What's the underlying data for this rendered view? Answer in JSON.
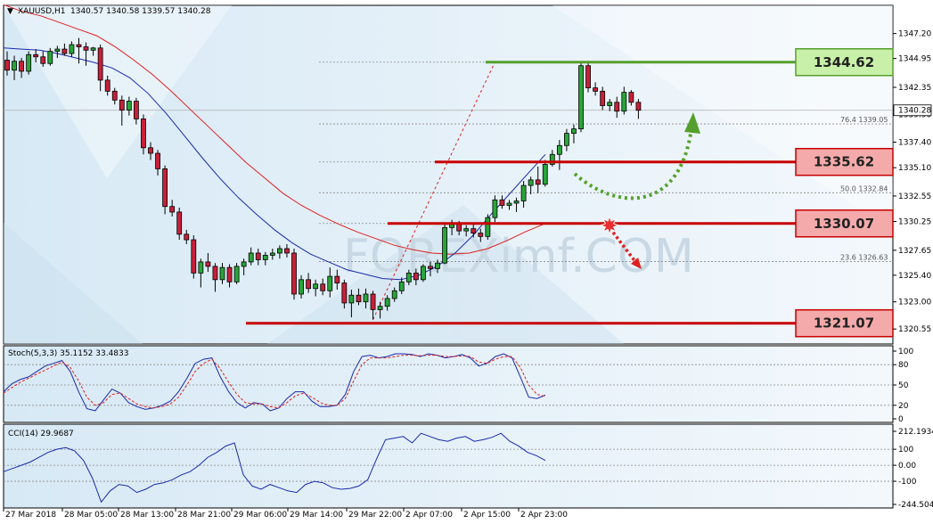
{
  "chart_data": [
    {
      "type": "candlestick",
      "title": "XAUUSD,H1",
      "ohlc_header": "1340.57 1340.58 1339.57 1340.28",
      "ylim": [
        1319.6,
        1348.7
      ],
      "y_ticks": [
        "1347.20",
        "1344.95",
        "1342.35",
        "1339.90",
        "1337.40",
        "1335.10",
        "1332.55",
        "1330.25",
        "1327.65",
        "1325.40",
        "1323.00",
        "1320.55"
      ],
      "x_ticks": [
        "27 Mar 2018",
        "28 Mar 05:00",
        "28 Mar 13:00",
        "28 Mar 21:00",
        "29 Mar 06:00",
        "29 Mar 14:00",
        "29 Mar 22:00",
        "2 Apr 07:00",
        "2 Apr 15:00",
        "2 Apr 23:00"
      ],
      "current_price": "1340.28",
      "candles": [
        [
          1344.8,
          1345.6,
          1343.4,
          1343.9
        ],
        [
          1343.9,
          1345.2,
          1343.0,
          1344.7
        ],
        [
          1344.7,
          1345.0,
          1343.2,
          1343.8
        ],
        [
          1343.8,
          1345.6,
          1343.5,
          1345.3
        ],
        [
          1345.3,
          1345.8,
          1344.6,
          1345.1
        ],
        [
          1345.1,
          1345.6,
          1344.2,
          1344.5
        ],
        [
          1344.5,
          1345.9,
          1344.3,
          1345.6
        ],
        [
          1345.6,
          1346.1,
          1345.0,
          1345.8
        ],
        [
          1345.8,
          1346.3,
          1345.2,
          1345.4
        ],
        [
          1345.4,
          1346.5,
          1345.1,
          1346.2
        ],
        [
          1346.2,
          1346.8,
          1344.5,
          1346.0
        ],
        [
          1346.0,
          1346.4,
          1344.3,
          1345.7
        ],
        [
          1345.7,
          1346.0,
          1345.2,
          1345.9
        ],
        [
          1345.9,
          1346.2,
          1342.0,
          1343.0
        ],
        [
          1343.0,
          1343.4,
          1341.6,
          1342.0
        ],
        [
          1342.0,
          1342.3,
          1340.8,
          1341.2
        ],
        [
          1341.2,
          1341.6,
          1338.9,
          1340.3
        ],
        [
          1340.3,
          1341.5,
          1339.8,
          1341.1
        ],
        [
          1341.1,
          1341.4,
          1339.0,
          1339.5
        ],
        [
          1339.5,
          1339.9,
          1336.3,
          1336.9
        ],
        [
          1336.9,
          1337.4,
          1335.8,
          1336.4
        ],
        [
          1336.4,
          1336.7,
          1334.4,
          1335.0
        ],
        [
          1335.0,
          1335.3,
          1330.9,
          1331.6
        ],
        [
          1331.6,
          1332.2,
          1330.7,
          1331.1
        ],
        [
          1331.1,
          1331.5,
          1328.6,
          1329.1
        ],
        [
          1329.1,
          1329.5,
          1328.2,
          1328.6
        ],
        [
          1328.6,
          1329.0,
          1325.1,
          1325.6
        ],
        [
          1325.6,
          1326.9,
          1324.3,
          1326.6
        ],
        [
          1326.6,
          1327.4,
          1325.7,
          1326.2
        ],
        [
          1326.2,
          1326.5,
          1323.9,
          1325.0
        ],
        [
          1325.0,
          1326.5,
          1324.6,
          1326.1
        ],
        [
          1326.1,
          1326.4,
          1324.3,
          1324.8
        ],
        [
          1324.8,
          1326.5,
          1324.6,
          1326.2
        ],
        [
          1326.2,
          1326.9,
          1325.4,
          1326.6
        ],
        [
          1326.6,
          1327.9,
          1326.3,
          1327.4
        ],
        [
          1327.4,
          1327.8,
          1326.3,
          1326.8
        ],
        [
          1326.8,
          1327.5,
          1326.3,
          1327.2
        ],
        [
          1327.2,
          1327.8,
          1326.8,
          1327.4
        ],
        [
          1327.4,
          1328.1,
          1326.9,
          1327.8
        ],
        [
          1327.8,
          1328.2,
          1327.0,
          1327.4
        ],
        [
          1327.4,
          1327.8,
          1323.2,
          1323.7
        ],
        [
          1323.7,
          1325.4,
          1323.3,
          1325.0
        ],
        [
          1325.0,
          1325.6,
          1323.8,
          1324.2
        ],
        [
          1324.2,
          1325.0,
          1323.5,
          1324.6
        ],
        [
          1324.6,
          1325.1,
          1323.6,
          1324.0
        ],
        [
          1324.0,
          1326.1,
          1323.4,
          1325.3
        ],
        [
          1325.3,
          1325.9,
          1324.1,
          1324.7
        ],
        [
          1324.7,
          1325.0,
          1322.4,
          1322.9
        ],
        [
          1322.9,
          1324.1,
          1321.6,
          1323.6
        ],
        [
          1323.6,
          1324.2,
          1322.7,
          1323.0
        ],
        [
          1323.0,
          1324.2,
          1322.4,
          1323.7
        ],
        [
          1323.7,
          1324.0,
          1321.4,
          1322.3
        ],
        [
          1322.3,
          1323.0,
          1321.5,
          1322.6
        ],
        [
          1322.6,
          1323.6,
          1322.2,
          1323.3
        ],
        [
          1323.3,
          1324.3,
          1323.0,
          1324.0
        ],
        [
          1324.0,
          1325.2,
          1323.7,
          1324.8
        ],
        [
          1324.8,
          1325.9,
          1324.5,
          1325.6
        ],
        [
          1325.6,
          1326.0,
          1324.5,
          1325.0
        ],
        [
          1325.0,
          1326.4,
          1324.8,
          1326.2
        ],
        [
          1326.2,
          1326.6,
          1325.3,
          1326.0
        ],
        [
          1326.0,
          1326.8,
          1325.6,
          1326.5
        ],
        [
          1326.5,
          1330.1,
          1326.4,
          1329.7
        ],
        [
          1329.7,
          1330.4,
          1329.0,
          1330.0
        ],
        [
          1330.0,
          1330.3,
          1329.0,
          1329.4
        ],
        [
          1329.4,
          1329.9,
          1328.9,
          1329.6
        ],
        [
          1329.6,
          1330.0,
          1328.8,
          1329.2
        ],
        [
          1329.2,
          1329.6,
          1328.4,
          1328.9
        ],
        [
          1328.9,
          1330.9,
          1328.6,
          1330.6
        ],
        [
          1330.6,
          1332.6,
          1330.2,
          1332.2
        ],
        [
          1332.2,
          1332.6,
          1331.4,
          1331.7
        ],
        [
          1331.7,
          1332.2,
          1331.3,
          1331.9
        ],
        [
          1331.9,
          1332.4,
          1331.1,
          1332.1
        ],
        [
          1332.1,
          1333.9,
          1331.5,
          1333.5
        ],
        [
          1333.5,
          1334.3,
          1332.7,
          1334.0
        ],
        [
          1334.0,
          1335.2,
          1332.8,
          1333.6
        ],
        [
          1333.6,
          1335.8,
          1333.4,
          1335.4
        ],
        [
          1335.4,
          1336.7,
          1335.2,
          1336.3
        ],
        [
          1336.3,
          1337.6,
          1334.9,
          1337.1
        ],
        [
          1337.1,
          1338.6,
          1336.6,
          1338.2
        ],
        [
          1338.2,
          1339.0,
          1337.3,
          1338.6
        ],
        [
          1338.6,
          1344.7,
          1338.3,
          1344.3
        ],
        [
          1344.3,
          1344.62,
          1341.9,
          1342.3
        ],
        [
          1342.3,
          1342.8,
          1341.6,
          1342.0
        ],
        [
          1342.0,
          1342.4,
          1340.3,
          1340.7
        ],
        [
          1340.7,
          1341.3,
          1340.2,
          1341.0
        ],
        [
          1341.0,
          1341.5,
          1339.6,
          1340.2
        ],
        [
          1340.2,
          1342.4,
          1339.9,
          1341.9
        ],
        [
          1341.9,
          1342.1,
          1340.7,
          1341.0
        ],
        [
          1341.0,
          1341.3,
          1339.5,
          1340.28
        ]
      ],
      "ma_fast": [
        1345.9,
        1345.8,
        1345.7,
        1345.4,
        1345.0,
        1344.6,
        1344.1,
        1343.2,
        1341.8,
        1340.0,
        1338.0,
        1336.0,
        1334.1,
        1332.4,
        1330.9,
        1329.5,
        1328.3,
        1327.3,
        1326.6,
        1325.9,
        1325.5,
        1325.1,
        1325.0,
        1325.4,
        1326.2,
        1327.4,
        1329.0,
        1330.9,
        1332.7,
        1334.5,
        1336.3
      ],
      "ma_slow": [
        1349.8,
        1349.2,
        1348.8,
        1348.2,
        1347.6,
        1347.0,
        1346.0,
        1344.8,
        1343.5,
        1342.0,
        1340.4,
        1338.8,
        1337.2,
        1335.6,
        1334.2,
        1332.8,
        1331.7,
        1330.8,
        1330.0,
        1329.3,
        1328.7,
        1328.1,
        1327.7,
        1327.4,
        1327.3,
        1327.4,
        1327.8,
        1328.5,
        1329.3,
        1330.0
      ],
      "fib_levels": [
        {
          "label": "76.4",
          "value": "1339.05"
        },
        {
          "label": "50.0",
          "value": "1332.84"
        },
        {
          "label": "23.6",
          "value": "1326.63"
        }
      ],
      "levels": [
        {
          "label": "1344.62",
          "value": 1344.62,
          "kind": "resistance-target",
          "color": "#55a02d",
          "fill": "#c8f0a8"
        },
        {
          "label": "1335.62",
          "value": 1335.62,
          "kind": "support",
          "color": "#c80000",
          "fill": "#f4aaaa"
        },
        {
          "label": "1330.07",
          "value": 1330.07,
          "kind": "support",
          "color": "#c80000",
          "fill": "#f4aaaa"
        },
        {
          "label": "1321.07",
          "value": 1321.07,
          "kind": "support",
          "color": "#c80000",
          "fill": "#f4aaaa"
        }
      ],
      "watermark": "FOREXimf.COM"
    },
    {
      "type": "line",
      "title": "Stoch(5,3,3) 35.1152 33.4833",
      "ylim": [
        0,
        100
      ],
      "y_ticks": [
        "100",
        "80",
        "50",
        "20",
        "0"
      ],
      "series": [
        {
          "values": [
            40,
            52,
            58,
            62,
            70,
            78,
            82,
            86,
            70,
            40,
            15,
            12,
            28,
            44,
            38,
            24,
            18,
            14,
            16,
            20,
            26,
            40,
            60,
            82,
            88,
            90,
            62,
            40,
            24,
            16,
            24,
            22,
            12,
            16,
            30,
            40,
            40,
            26,
            18,
            18,
            20,
            36,
            70,
            92,
            94,
            90,
            92,
            96,
            96,
            95,
            92,
            96,
            94,
            90,
            92,
            95,
            90,
            78,
            82,
            92,
            96,
            90,
            62,
            32,
            30,
            35
          ]
        },
        {
          "values": [
            38,
            46,
            54,
            60,
            66,
            72,
            78,
            84,
            76,
            56,
            32,
            20,
            24,
            36,
            38,
            30,
            22,
            18,
            16,
            18,
            22,
            32,
            50,
            70,
            82,
            88,
            74,
            54,
            36,
            24,
            22,
            22,
            18,
            16,
            24,
            34,
            38,
            32,
            24,
            20,
            20,
            30,
            56,
            80,
            90,
            90,
            90,
            92,
            94,
            94,
            93,
            94,
            94,
            92,
            92,
            93,
            92,
            84,
            82,
            88,
            92,
            92,
            76,
            50,
            36,
            33
          ]
        }
      ]
    },
    {
      "type": "line",
      "title": "CCI(14) 29.9687",
      "ylim": [
        -244.5044,
        212.1934
      ],
      "y_ticks": [
        "212.1934",
        "100",
        "0.00",
        "-100",
        "-244.5044"
      ],
      "series": [
        {
          "values": [
            -40,
            -20,
            0,
            20,
            50,
            80,
            100,
            110,
            90,
            30,
            -80,
            -230,
            -160,
            -120,
            -130,
            -170,
            -150,
            -120,
            -110,
            -90,
            -60,
            -40,
            0,
            50,
            80,
            120,
            140,
            -60,
            -130,
            -150,
            -120,
            -140,
            -160,
            -170,
            -120,
            -100,
            -110,
            -140,
            -150,
            -145,
            -130,
            -90,
            40,
            160,
            170,
            180,
            140,
            200,
            180,
            160,
            150,
            170,
            180,
            150,
            160,
            175,
            200,
            150,
            120,
            80,
            60,
            30
          ]
        }
      ]
    }
  ]
}
